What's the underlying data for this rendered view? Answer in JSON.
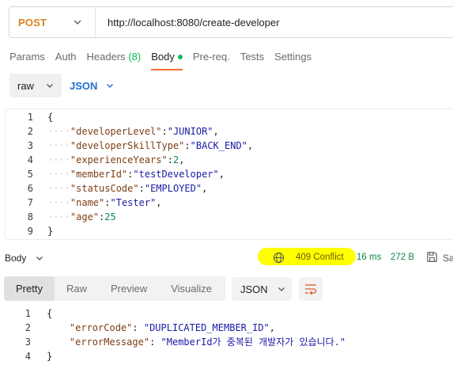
{
  "request": {
    "method": "POST",
    "url": "http://localhost:8080/create-developer"
  },
  "request_tabs": [
    {
      "label": "Params"
    },
    {
      "label": "Auth"
    },
    {
      "label": "Headers",
      "count": "(8)"
    },
    {
      "label": "Body",
      "active": true
    },
    {
      "label": "Pre-req."
    },
    {
      "label": "Tests"
    },
    {
      "label": "Settings"
    }
  ],
  "body_options": {
    "mode": "raw",
    "language": "JSON"
  },
  "request_body": [
    {
      "n": "1",
      "text": "{"
    },
    {
      "n": "2",
      "key": "\"developerLevel\"",
      "value": "\"JUNIOR\"",
      "kind": "str",
      "comma": ","
    },
    {
      "n": "3",
      "key": "\"developerSkillType\"",
      "value": "\"BACK_END\"",
      "kind": "str",
      "comma": ","
    },
    {
      "n": "4",
      "key": "\"experienceYears\"",
      "value": "2",
      "kind": "num",
      "comma": ","
    },
    {
      "n": "5",
      "key": "\"memberId\"",
      "value": "\"testDeveloper\"",
      "kind": "str",
      "comma": ","
    },
    {
      "n": "6",
      "key": "\"statusCode\"",
      "value": "\"EMPLOYED\"",
      "kind": "str",
      "comma": ","
    },
    {
      "n": "7",
      "key": "\"name\"",
      "value": "\"Tester\"",
      "kind": "str",
      "comma": ","
    },
    {
      "n": "8",
      "key": "\"age\"",
      "value": "25",
      "kind": "num",
      "comma": ""
    },
    {
      "n": "9",
      "text": "}"
    }
  ],
  "response": {
    "section_label": "Body",
    "status": "409 Conflict",
    "time": "16 ms",
    "size": "272 B",
    "save_label": "Sa",
    "highlight_color": "#ffff00"
  },
  "response_tabs": [
    {
      "label": "Pretty",
      "active": true
    },
    {
      "label": "Raw"
    },
    {
      "label": "Preview"
    },
    {
      "label": "Visualize"
    }
  ],
  "response_format": "JSON",
  "response_body": [
    {
      "n": "1",
      "text": "{"
    },
    {
      "n": "2",
      "key": "\"errorCode\"",
      "value": "\"DUPLICATED_MEMBER_ID\"",
      "comma": ","
    },
    {
      "n": "3",
      "key": "\"errorMessage\"",
      "value": "\"MemberId가 중복된 개발자가 있습니다.\"",
      "comma": ""
    },
    {
      "n": "4",
      "text": "}"
    }
  ],
  "colors": {
    "accent": "#ff6c37",
    "method": "#d9831f",
    "json_link": "#1f6fd1",
    "success_green": "#0cbb52"
  }
}
